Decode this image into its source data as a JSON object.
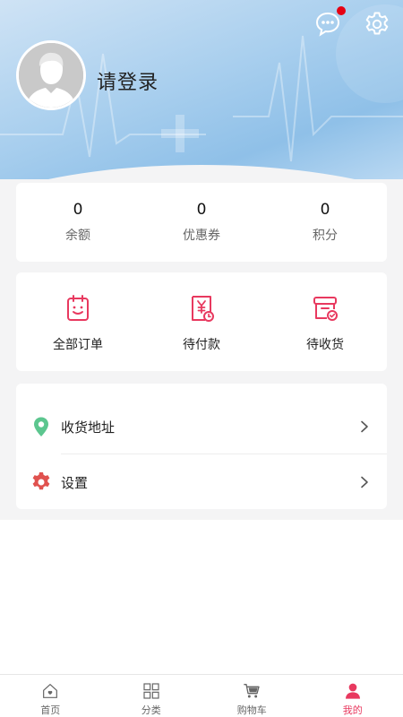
{
  "header": {
    "login_text": "请登录",
    "has_unread_message": true
  },
  "stats": [
    {
      "value": "0",
      "label": "余额"
    },
    {
      "value": "0",
      "label": "优惠券"
    },
    {
      "value": "0",
      "label": "积分"
    }
  ],
  "orders": [
    {
      "label": "全部订单",
      "icon": "order-list-icon"
    },
    {
      "label": "待付款",
      "icon": "pending-payment-icon"
    },
    {
      "label": "待收货",
      "icon": "pending-receipt-icon"
    }
  ],
  "menu": [
    {
      "label": "收货地址",
      "icon": "location-pin-icon"
    },
    {
      "label": "设置",
      "icon": "gear-icon"
    }
  ],
  "tabbar": [
    {
      "label": "首页",
      "icon": "home-icon",
      "active": false
    },
    {
      "label": "分类",
      "icon": "category-grid-icon",
      "active": false
    },
    {
      "label": "购物车",
      "icon": "cart-icon",
      "active": false
    },
    {
      "label": "我的",
      "icon": "user-icon",
      "active": true
    }
  ],
  "colors": {
    "accent": "#e8395f",
    "location_pin": "#5cc68f",
    "settings_gear": "#e0524f",
    "unread_dot": "#e60012"
  }
}
